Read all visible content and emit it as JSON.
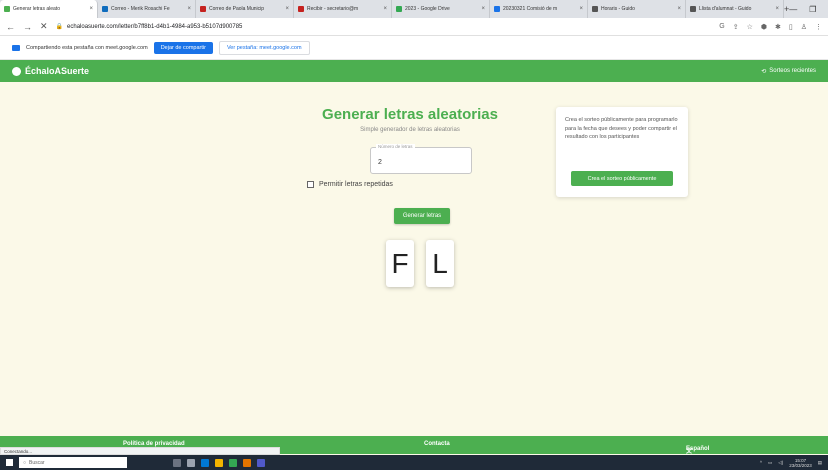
{
  "browser": {
    "tabs": [
      {
        "title": "Generar letras aleato",
        "active": true,
        "color": "#4caf50"
      },
      {
        "title": "Correo - Merik Rosachi Fe",
        "active": false,
        "color": "#0f6cbd"
      },
      {
        "title": "Correo de Paola Municip",
        "active": false,
        "color": "#c5221f"
      },
      {
        "title": "Recibir - secretario@m",
        "active": false,
        "color": "#c5221f"
      },
      {
        "title": "2023 - Google Drive",
        "active": false,
        "color": "#34a853"
      },
      {
        "title": "20230321 Comisió de m",
        "active": false,
        "color": "#1a73e8"
      },
      {
        "title": "Horaris - Guido",
        "active": false,
        "color": "#555555"
      },
      {
        "title": "Llista d'alumnat - Guido",
        "active": false,
        "color": "#555555"
      }
    ],
    "url": "echaloasuerte.com/letter/b7ff8b1-d4b1-4984-a953-b5107d900785"
  },
  "share_bar": {
    "message": "Compartiendo esta pestaña con meet.google.com",
    "stop_label": "Dejar de compartir",
    "view_label": "Ver pestaña: meet.google.com"
  },
  "header": {
    "brand": "ÉchaloASuerte",
    "recent": "Sorteos recientes"
  },
  "main": {
    "title": "Generar letras aleatorias",
    "subtitle": "Simple generador de letras aleatorias",
    "field_label": "Número de letras",
    "field_value": "2",
    "checkbox_label": "Permitir letras repetidas",
    "generate_label": "Generar letras",
    "letters": [
      "F",
      "L"
    ]
  },
  "card": {
    "text": "Crea el sorteo públicamente para programarlo para la fecha que desees y poder compartir el resultado con los participantes",
    "button": "Crea el sorteo públicamente"
  },
  "footer": {
    "privacy": "Política de privacidad",
    "contact": "Contacta",
    "language": "Español"
  },
  "status": "Conectando...",
  "taskbar": {
    "search": "Buscar",
    "time": "15:07",
    "date": "23/03/2023"
  },
  "colors": {
    "brand_green": "#4caf50",
    "background": "#fbf9e8"
  }
}
